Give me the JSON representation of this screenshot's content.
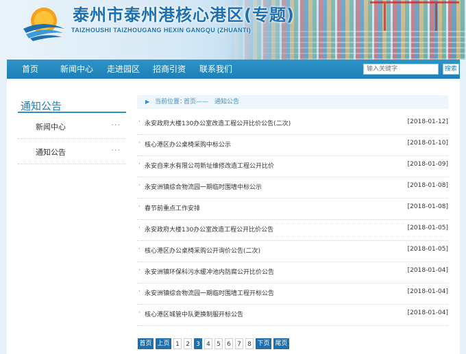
{
  "header": {
    "title": "泰州市泰州港核心港区(专题)",
    "subtitle": "TAIZHOUSHI TAIZHOUGANG HEXIN GANGQU (ZHUANTI)"
  },
  "nav": {
    "items": [
      {
        "label": "首页"
      },
      {
        "label": "新闻中心"
      },
      {
        "label": "走进园区"
      },
      {
        "label": "招商引资"
      },
      {
        "label": "联系我们"
      }
    ],
    "search_placeholder": "输入关键字",
    "search_button": "搜索"
  },
  "sidebar": {
    "title": "通知公告",
    "items": [
      {
        "label": "新闻中心",
        "more": "···"
      },
      {
        "label": "通知公告",
        "more": "···"
      }
    ]
  },
  "breadcrumb": {
    "label": "当前位置：",
    "home": "首页",
    "separator": "——",
    "current": "通知公告"
  },
  "news": [
    {
      "title": "永安政府大楼130办公室改造工程公开比价公告(二次)",
      "date": "[2018-01-12]"
    },
    {
      "title": "核心港区办公桌椅采购中标公示",
      "date": "[2018-01-10]"
    },
    {
      "title": "永安自来水有限公司新址维修改造工程公开比价",
      "date": "[2018-01-09]"
    },
    {
      "title": "永安洲镇综合物流园一期临时围墙中标公示",
      "date": "[2018-01-08]"
    },
    {
      "title": "春节前重点工作安排",
      "date": "[2018-01-08]"
    },
    {
      "title": "永安政府大楼130办公室改造工程公开比价公告",
      "date": "[2018-01-05]"
    },
    {
      "title": "核心港区办公桌椅采购公开询价公告(二次)",
      "date": "[2018-01-05]"
    },
    {
      "title": "永安洲镇环保科污水缓冲池内防腐公开比价公告",
      "date": "[2018-01-04]"
    },
    {
      "title": "永安洲镇综合物流园一期临时围墙工程开标公告",
      "date": "[2018-01-04]"
    },
    {
      "title": "核心港区城管中队更换制服开标公告",
      "date": "[2018-01-04]"
    }
  ],
  "pager": {
    "first": "首页",
    "prev": "上页",
    "pages": [
      "1",
      "2",
      "3",
      "4",
      "5",
      "6",
      "7",
      "8"
    ],
    "current": 3,
    "next": "下页",
    "last": "尾页"
  },
  "colors": {
    "accent": "#1d7fb6",
    "nav_bg": "#2388be",
    "page_bg": "#e6f1f8",
    "pager_blue": "#1d6fae"
  }
}
